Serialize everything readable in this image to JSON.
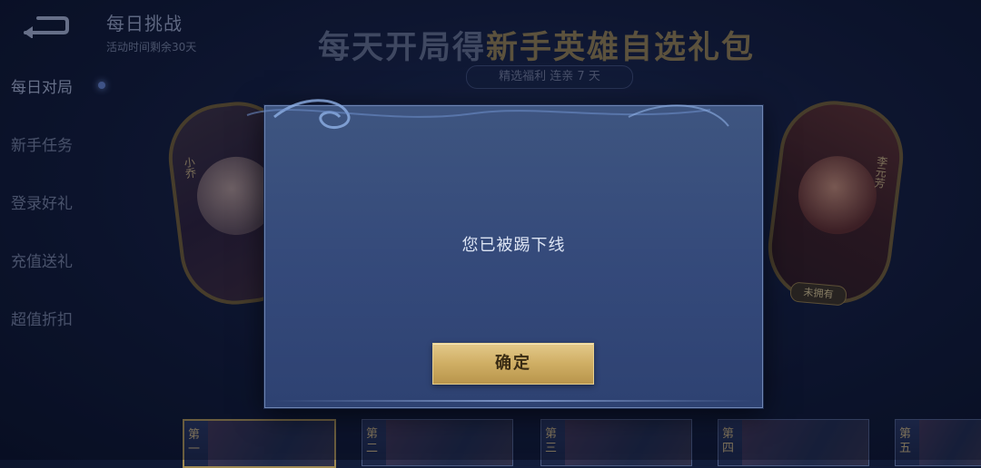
{
  "header": {
    "title": "每日挑战",
    "subtitle": "活动时间剩余30天"
  },
  "sidebar": {
    "items": [
      {
        "label": "每日对局",
        "active": true
      },
      {
        "label": "新手任务"
      },
      {
        "label": "登录好礼"
      },
      {
        "label": "充值送礼"
      },
      {
        "label": "超值折扣"
      }
    ]
  },
  "banner": {
    "title_prefix": "每天开局得",
    "title_highlight": "新手英雄自选礼包",
    "pill": "精选福利 连亲 7 天"
  },
  "heroes": {
    "left_name": "小乔",
    "right_name": "李元芳",
    "right_plate": "未拥有"
  },
  "days": [
    {
      "label": "第一"
    },
    {
      "label": "第二"
    },
    {
      "label": "第三"
    },
    {
      "label": "第四"
    },
    {
      "label": "第五"
    }
  ],
  "modal": {
    "message": "您已被踢下线",
    "confirm_label": "确定"
  },
  "colors": {
    "modal_bg": "#3a5080",
    "confirm_gold": "#d2b06a",
    "text_light": "#dde5f4"
  }
}
